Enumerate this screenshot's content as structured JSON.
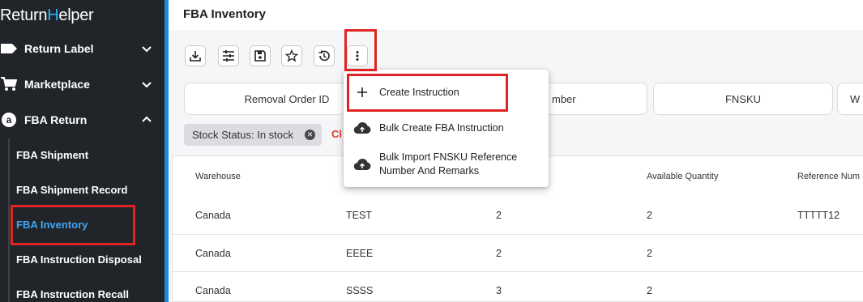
{
  "app": {
    "logo_pre": "R",
    "logo_mid": "eturn",
    "logo_accent": "H",
    "logo_post": "elper"
  },
  "sidebar": {
    "items": [
      {
        "label": "Return Label",
        "icon": "label-icon",
        "expanded": false
      },
      {
        "label": "Marketplace",
        "icon": "cart-icon",
        "expanded": false
      },
      {
        "label": "FBA Return",
        "icon": "amazon-icon",
        "expanded": true
      }
    ],
    "sub_items": [
      {
        "label": "FBA Shipment"
      },
      {
        "label": "FBA Shipment Record"
      },
      {
        "label": "FBA Inventory",
        "active": true
      },
      {
        "label": "FBA Instruction Disposal"
      },
      {
        "label": "FBA Instruction Recall"
      }
    ]
  },
  "page": {
    "title": "FBA Inventory"
  },
  "toolbar": {
    "buttons": [
      "download-icon",
      "filter-settings-icon",
      "save-icon",
      "star-icon",
      "history-icon",
      "more-vert-icon"
    ]
  },
  "search_fields": [
    {
      "label": "Removal Order ID"
    },
    {
      "label": "mber"
    },
    {
      "label": "FNSKU"
    },
    {
      "label": "W"
    }
  ],
  "filters": {
    "chip_label": "Stock Status: In stock",
    "clear_label": "Cl"
  },
  "table": {
    "headers": [
      "Warehouse",
      "Available Quantity",
      "Reference Num"
    ],
    "rows": [
      {
        "warehouse": "Canada",
        "col2": "TEST",
        "col3": "2",
        "available": "2",
        "reference": "TTTTT12"
      },
      {
        "warehouse": "Canada",
        "col2": "EEEE",
        "col3": "2",
        "available": "2",
        "reference": ""
      },
      {
        "warehouse": "Canada",
        "col2": "SSSS",
        "col3": "3",
        "available": "2",
        "reference": ""
      }
    ]
  },
  "menu": {
    "items": [
      {
        "label": "Create Instruction",
        "icon": "plus-icon"
      },
      {
        "label": "Bulk Create FBA Instruction",
        "icon": "cloud-upload-icon"
      },
      {
        "label_line1": "Bulk Import FNSKU Reference",
        "label_line2": "Number And Remarks",
        "icon": "cloud-upload-icon"
      }
    ]
  },
  "colors": {
    "sidebar_bg": "#212529",
    "accent": "#1e88e5",
    "active_link": "#42a5f5",
    "highlight": "#e02424",
    "clear": "#e53935"
  }
}
